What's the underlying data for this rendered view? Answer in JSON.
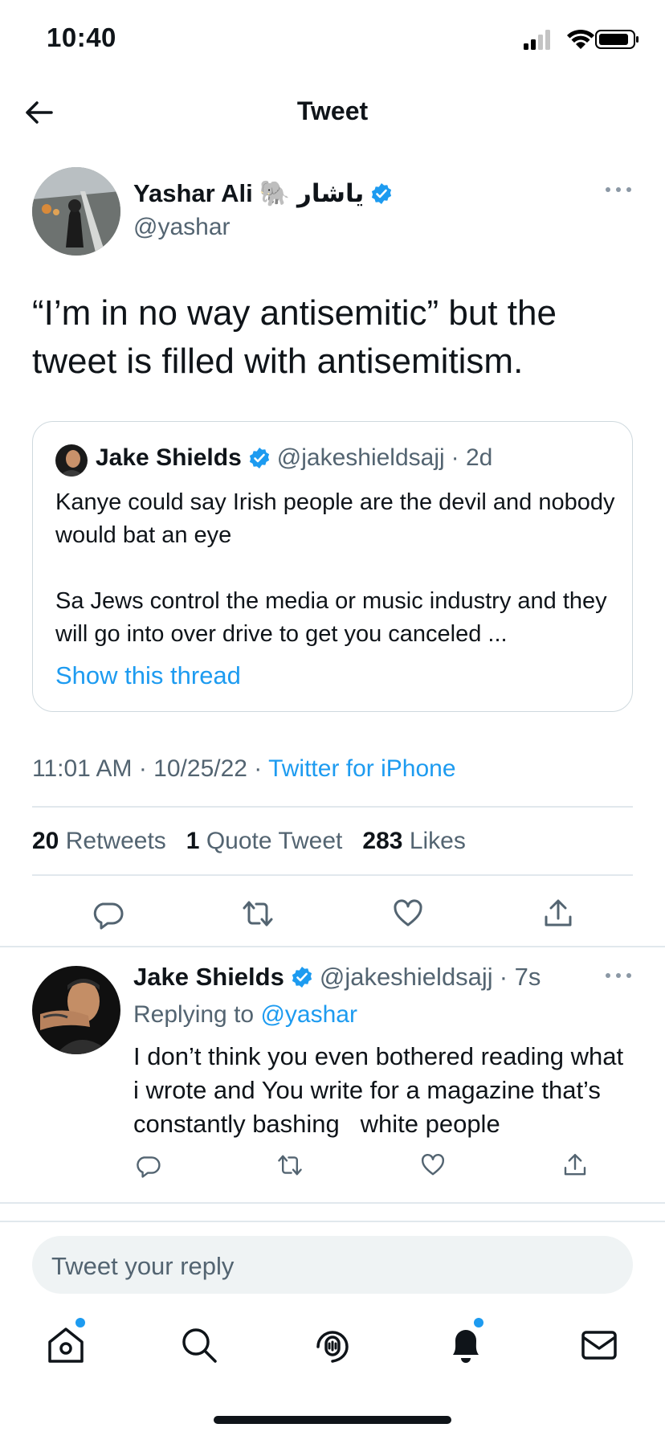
{
  "status_bar": {
    "time": "10:40"
  },
  "header": {
    "title": "Tweet",
    "back_icon": "arrow-left-icon"
  },
  "tweet": {
    "author_name": "Yashar Ali",
    "author_name_suffix": "🐘 ياشار",
    "handle": "@yashar",
    "text": "“I’m in no way antisemitic” but the tweet is filled with antisemitism.",
    "timestamp": "11:01 AM · 10/25/22 · ",
    "source": "Twitter for iPhone",
    "stats": {
      "retweets_count": "20",
      "retweets_label": "Retweets",
      "quotes_count": "1",
      "quotes_label": "Quote Tweet",
      "likes_count": "283",
      "likes_label": "Likes"
    }
  },
  "quote": {
    "name": "Jake Shields",
    "handle": "@jakeshieldsajj",
    "time": "· 2d",
    "line1": "Kanye could say Irish people are the devil and nobody would bat an eye",
    "line2": "Sa Jews control the media or music industry and they will go into over drive to get you canceled ...",
    "show_thread": "Show this thread"
  },
  "reply": {
    "name": "Jake Shields",
    "handle": "@jakeshieldsajj",
    "time": "· 7s",
    "replying_label": "Replying to ",
    "replying_to": "@yashar",
    "text": "I don’t think you even bothered reading what i wrote and You write for a magazine that’s constantly bashing   white people"
  },
  "compose": {
    "placeholder": "Tweet your reply"
  },
  "colors": {
    "accent": "#1d9bf0",
    "text": "#0f1419",
    "secondary": "#536471",
    "divider": "#e1e8ed"
  },
  "tab_bar": [
    "home-icon",
    "search-icon",
    "spaces-icon",
    "notifications-icon",
    "messages-icon"
  ]
}
